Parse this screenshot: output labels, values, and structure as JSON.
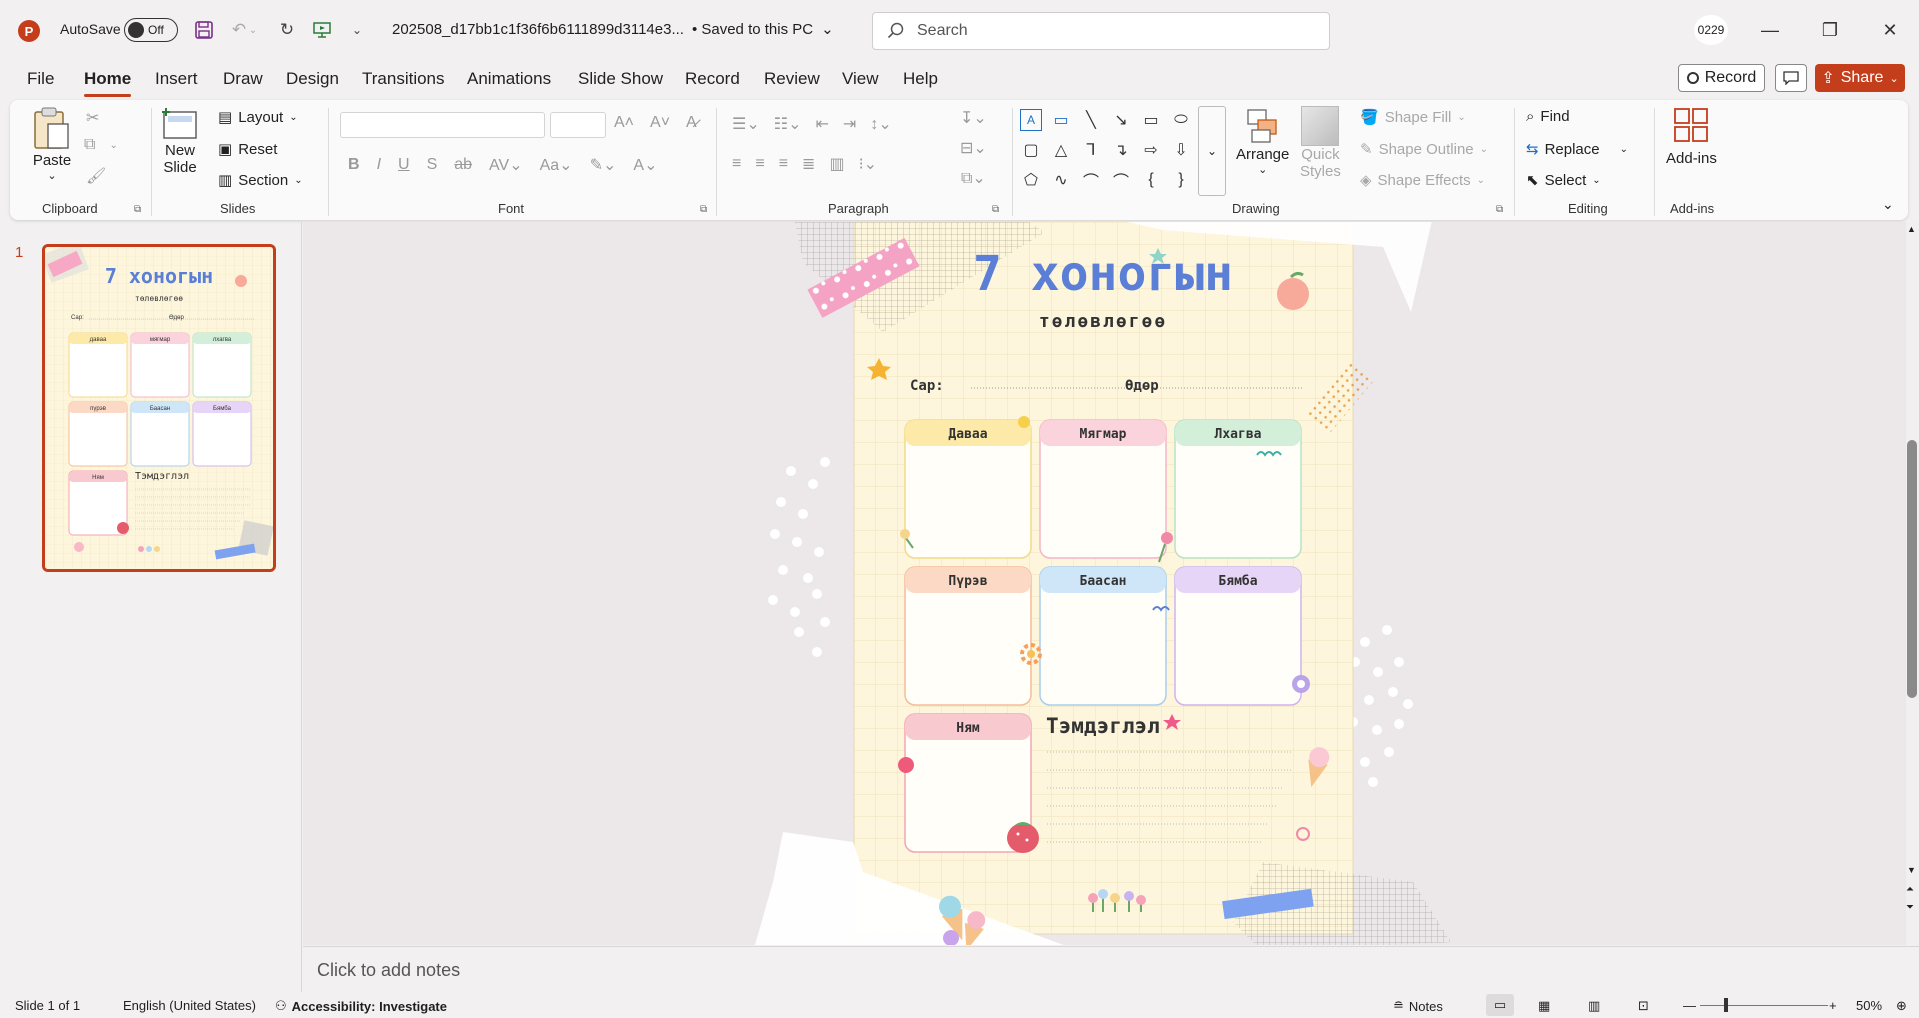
{
  "titlebar": {
    "app_logo": "P",
    "autosave_label": "AutoSave",
    "autosave_state": "Off",
    "file_name": "202508_d17bb1c1f36f6b6111899d3114e3...",
    "save_status": "• Saved to this PC",
    "search_placeholder": "Search",
    "user_initials": "0229"
  },
  "menu": {
    "tabs": [
      "File",
      "Home",
      "Insert",
      "Draw",
      "Design",
      "Transitions",
      "Animations",
      "Slide Show",
      "Record",
      "Review",
      "View",
      "Help"
    ],
    "active_tab": "Home",
    "record_label": "Record",
    "share_label": "Share"
  },
  "ribbon": {
    "clipboard": {
      "label": "Clipboard",
      "paste": "Paste"
    },
    "slides": {
      "label": "Slides",
      "new_slide_1": "New",
      "new_slide_2": "Slide",
      "layout": "Layout",
      "reset": "Reset",
      "section": "Section"
    },
    "font": {
      "label": "Font"
    },
    "paragraph": {
      "label": "Paragraph"
    },
    "drawing": {
      "label": "Drawing",
      "arrange": "Arrange",
      "quick_styles_1": "Quick",
      "quick_styles_2": "Styles",
      "shape_fill": "Shape Fill",
      "shape_outline": "Shape Outline",
      "shape_effects": "Shape Effects"
    },
    "editing": {
      "label": "Editing",
      "find": "Find",
      "replace": "Replace",
      "select": "Select"
    },
    "addins": {
      "label": "Add-ins",
      "button": "Add-ins"
    }
  },
  "thumbnail": {
    "number": "1"
  },
  "slide": {
    "title": "7 хоногын",
    "subtitle": "төлөвлөгөө",
    "month_label": "Сар:",
    "day_label": "Өдөр",
    "days": [
      {
        "name": "Даваа",
        "color": "#fde9a8"
      },
      {
        "name": "Мягмар",
        "color": "#fbd3dc"
      },
      {
        "name": "Лхагва",
        "color": "#d3efd9"
      },
      {
        "name": "Пүрэв",
        "color": "#fcd9c4"
      },
      {
        "name": "Баасан",
        "color": "#cfe5f8"
      },
      {
        "name": "Бямба",
        "color": "#e7d5f7"
      },
      {
        "name": "Ням",
        "color": "#f9c9d0"
      }
    ],
    "notes_title": "Тэмдэглэл"
  },
  "notes": {
    "placeholder": "Click to add notes"
  },
  "status": {
    "slide_info": "Slide 1 of 1",
    "language": "English (United States)",
    "accessibility": "Accessibility: Investigate",
    "notes_button": "Notes",
    "zoom": "50%"
  }
}
